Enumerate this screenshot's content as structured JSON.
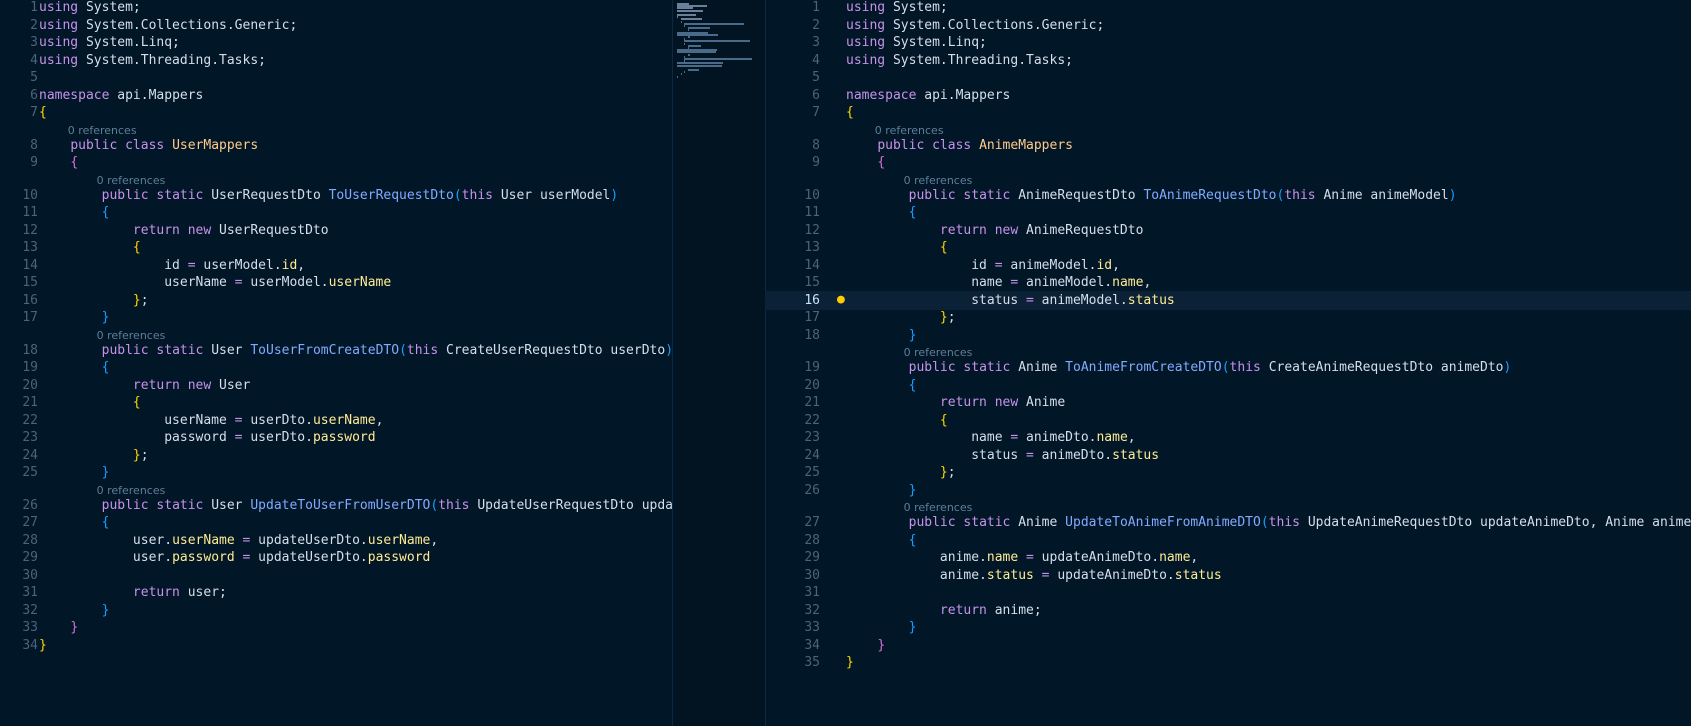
{
  "left": {
    "file_class": "UserMappers",
    "lines": [
      {
        "n": "1",
        "t": [
          [
            "kw",
            "using"
          ],
          [
            "ns",
            " System;"
          ]
        ]
      },
      {
        "n": "2",
        "t": [
          [
            "kw",
            "using"
          ],
          [
            "ns",
            " System.Collections.Generic;"
          ]
        ]
      },
      {
        "n": "3",
        "t": [
          [
            "kw",
            "using"
          ],
          [
            "ns",
            " System.Linq;"
          ]
        ]
      },
      {
        "n": "4",
        "t": [
          [
            "kw",
            "using"
          ],
          [
            "ns",
            " System.Threading.Tasks;"
          ]
        ]
      },
      {
        "n": "5",
        "t": []
      },
      {
        "n": "6",
        "t": [
          [
            "kw",
            "namespace"
          ],
          [
            "ns",
            " api.Mappers"
          ]
        ]
      },
      {
        "n": "7",
        "t": [
          [
            "brace-y",
            "{"
          ]
        ]
      },
      {
        "n": "8",
        "ref": "0 references",
        "t": [
          [
            "ns",
            "    "
          ],
          [
            "kw",
            "public class "
          ],
          [
            "cls",
            "UserMappers"
          ]
        ]
      },
      {
        "n": "9",
        "t": [
          [
            "ns",
            "    "
          ],
          [
            "brace-p",
            "{"
          ]
        ]
      },
      {
        "n": "10",
        "ref": "0 references",
        "t": [
          [
            "ns",
            "        "
          ],
          [
            "kw",
            "public static "
          ],
          [
            "ns",
            "UserRequestDto "
          ],
          [
            "fn",
            "ToUserRequestDto"
          ],
          [
            "brace-b",
            "("
          ],
          [
            "kw",
            "this "
          ],
          [
            "ns",
            "User userModel"
          ],
          [
            "brace-b",
            ")"
          ]
        ]
      },
      {
        "n": "11",
        "t": [
          [
            "ns",
            "        "
          ],
          [
            "brace-b",
            "{"
          ]
        ]
      },
      {
        "n": "12",
        "t": [
          [
            "ns",
            "            "
          ],
          [
            "kw",
            "return new "
          ],
          [
            "ns",
            "UserRequestDto"
          ]
        ]
      },
      {
        "n": "13",
        "t": [
          [
            "ns",
            "            "
          ],
          [
            "brace-y",
            "{"
          ]
        ]
      },
      {
        "n": "14",
        "t": [
          [
            "ns",
            "                id "
          ],
          [
            "op",
            "="
          ],
          [
            "ns",
            " userModel."
          ],
          [
            "prop",
            "id"
          ],
          [
            "ns",
            ","
          ]
        ]
      },
      {
        "n": "15",
        "t": [
          [
            "ns",
            "                userName "
          ],
          [
            "op",
            "="
          ],
          [
            "ns",
            " userModel."
          ],
          [
            "prop",
            "userName"
          ]
        ]
      },
      {
        "n": "16",
        "t": [
          [
            "ns",
            "            "
          ],
          [
            "brace-y",
            "}"
          ],
          [
            "ns",
            ";"
          ]
        ]
      },
      {
        "n": "17",
        "t": [
          [
            "ns",
            "        "
          ],
          [
            "brace-b",
            "}"
          ]
        ]
      },
      {
        "n": "18",
        "ref": "0 references",
        "t": [
          [
            "ns",
            "        "
          ],
          [
            "kw",
            "public static "
          ],
          [
            "ns",
            "User "
          ],
          [
            "fn",
            "ToUserFromCreateDTO"
          ],
          [
            "brace-b",
            "("
          ],
          [
            "kw",
            "this "
          ],
          [
            "ns",
            "CreateUserRequestDto userDto"
          ],
          [
            "brace-b",
            ")"
          ]
        ]
      },
      {
        "n": "19",
        "t": [
          [
            "ns",
            "        "
          ],
          [
            "brace-b",
            "{"
          ]
        ]
      },
      {
        "n": "20",
        "t": [
          [
            "ns",
            "            "
          ],
          [
            "kw",
            "return new "
          ],
          [
            "ns",
            "User"
          ]
        ]
      },
      {
        "n": "21",
        "t": [
          [
            "ns",
            "            "
          ],
          [
            "brace-y",
            "{"
          ]
        ]
      },
      {
        "n": "22",
        "t": [
          [
            "ns",
            "                userName "
          ],
          [
            "op",
            "="
          ],
          [
            "ns",
            " userDto."
          ],
          [
            "prop",
            "userName"
          ],
          [
            "ns",
            ","
          ]
        ]
      },
      {
        "n": "23",
        "t": [
          [
            "ns",
            "                password "
          ],
          [
            "op",
            "="
          ],
          [
            "ns",
            " userDto."
          ],
          [
            "prop",
            "password"
          ]
        ]
      },
      {
        "n": "24",
        "t": [
          [
            "ns",
            "            "
          ],
          [
            "brace-y",
            "}"
          ],
          [
            "ns",
            ";"
          ]
        ]
      },
      {
        "n": "25",
        "t": [
          [
            "ns",
            "        "
          ],
          [
            "brace-b",
            "}"
          ]
        ]
      },
      {
        "n": "26",
        "ref": "0 references",
        "t": [
          [
            "ns",
            "        "
          ],
          [
            "kw",
            "public static "
          ],
          [
            "ns",
            "User "
          ],
          [
            "fn",
            "UpdateToUserFromUserDTO"
          ],
          [
            "brace-b",
            "("
          ],
          [
            "kw",
            "this "
          ],
          [
            "ns",
            "UpdateUserRequestDto update"
          ]
        ]
      },
      {
        "n": "27",
        "t": [
          [
            "ns",
            "        "
          ],
          [
            "brace-b",
            "{"
          ]
        ]
      },
      {
        "n": "28",
        "t": [
          [
            "ns",
            "            user."
          ],
          [
            "prop",
            "userName"
          ],
          [
            "op",
            " ="
          ],
          [
            "ns",
            " updateUserDto."
          ],
          [
            "prop",
            "userName"
          ],
          [
            "ns",
            ","
          ]
        ]
      },
      {
        "n": "29",
        "t": [
          [
            "ns",
            "            user."
          ],
          [
            "prop",
            "password"
          ],
          [
            "op",
            " ="
          ],
          [
            "ns",
            " updateUserDto."
          ],
          [
            "prop",
            "password"
          ]
        ]
      },
      {
        "n": "30",
        "t": []
      },
      {
        "n": "31",
        "t": [
          [
            "ns",
            "            "
          ],
          [
            "kw",
            "return "
          ],
          [
            "ns",
            "user;"
          ]
        ]
      },
      {
        "n": "32",
        "t": [
          [
            "ns",
            "        "
          ],
          [
            "brace-b",
            "}"
          ]
        ]
      },
      {
        "n": "33",
        "t": [
          [
            "ns",
            "    "
          ],
          [
            "brace-p",
            "}"
          ]
        ]
      },
      {
        "n": "34",
        "t": [
          [
            "brace-y",
            "}"
          ]
        ]
      }
    ]
  },
  "right": {
    "file_class": "AnimeMappers",
    "active_line": "16",
    "lines": [
      {
        "n": "1",
        "t": [
          [
            "kw",
            "using"
          ],
          [
            "ns",
            " System;"
          ]
        ]
      },
      {
        "n": "2",
        "t": [
          [
            "kw",
            "using"
          ],
          [
            "ns",
            " System.Collections.Generic;"
          ]
        ]
      },
      {
        "n": "3",
        "t": [
          [
            "kw",
            "using"
          ],
          [
            "ns",
            " System.Linq;"
          ]
        ]
      },
      {
        "n": "4",
        "t": [
          [
            "kw",
            "using"
          ],
          [
            "ns",
            " System.Threading.Tasks;"
          ]
        ]
      },
      {
        "n": "5",
        "t": []
      },
      {
        "n": "6",
        "t": [
          [
            "kw",
            "namespace"
          ],
          [
            "ns",
            " api.Mappers"
          ]
        ]
      },
      {
        "n": "7",
        "t": [
          [
            "brace-y",
            "{"
          ]
        ]
      },
      {
        "n": "8",
        "ref": "0 references",
        "t": [
          [
            "ns",
            "    "
          ],
          [
            "kw",
            "public class "
          ],
          [
            "cls",
            "AnimeMappers"
          ]
        ]
      },
      {
        "n": "9",
        "t": [
          [
            "ns",
            "    "
          ],
          [
            "brace-p",
            "{"
          ]
        ]
      },
      {
        "n": "10",
        "ref": "0 references",
        "t": [
          [
            "ns",
            "        "
          ],
          [
            "kw",
            "public static "
          ],
          [
            "ns",
            "AnimeRequestDto "
          ],
          [
            "fn",
            "ToAnimeRequestDto"
          ],
          [
            "brace-b",
            "("
          ],
          [
            "kw",
            "this "
          ],
          [
            "ns",
            "Anime animeModel"
          ],
          [
            "brace-b",
            ")"
          ]
        ]
      },
      {
        "n": "11",
        "t": [
          [
            "ns",
            "        "
          ],
          [
            "brace-b",
            "{"
          ]
        ]
      },
      {
        "n": "12",
        "t": [
          [
            "ns",
            "            "
          ],
          [
            "kw",
            "return new "
          ],
          [
            "ns",
            "AnimeRequestDto"
          ]
        ]
      },
      {
        "n": "13",
        "t": [
          [
            "ns",
            "            "
          ],
          [
            "brace-y",
            "{"
          ]
        ]
      },
      {
        "n": "14",
        "t": [
          [
            "ns",
            "                id "
          ],
          [
            "op",
            "="
          ],
          [
            "ns",
            " animeModel."
          ],
          [
            "prop",
            "id"
          ],
          [
            "ns",
            ","
          ]
        ]
      },
      {
        "n": "15",
        "t": [
          [
            "ns",
            "                name "
          ],
          [
            "op",
            "="
          ],
          [
            "ns",
            " animeModel."
          ],
          [
            "prop",
            "name"
          ],
          [
            "ns",
            ","
          ]
        ]
      },
      {
        "n": "16",
        "t": [
          [
            "ns",
            "                status "
          ],
          [
            "op",
            "="
          ],
          [
            "ns",
            " animeModel."
          ],
          [
            "prop",
            "status"
          ]
        ]
      },
      {
        "n": "17",
        "t": [
          [
            "ns",
            "            "
          ],
          [
            "brace-y",
            "}"
          ],
          [
            "ns",
            ";"
          ]
        ]
      },
      {
        "n": "18",
        "t": [
          [
            "ns",
            "        "
          ],
          [
            "brace-b",
            "}"
          ]
        ]
      },
      {
        "n": "19",
        "ref": "0 references",
        "t": [
          [
            "ns",
            "        "
          ],
          [
            "kw",
            "public static "
          ],
          [
            "ns",
            "Anime "
          ],
          [
            "fn",
            "ToAnimeFromCreateDTO"
          ],
          [
            "brace-b",
            "("
          ],
          [
            "kw",
            "this "
          ],
          [
            "ns",
            "CreateAnimeRequestDto animeDto"
          ],
          [
            "brace-b",
            ")"
          ]
        ]
      },
      {
        "n": "20",
        "t": [
          [
            "ns",
            "        "
          ],
          [
            "brace-b",
            "{"
          ]
        ]
      },
      {
        "n": "21",
        "t": [
          [
            "ns",
            "            "
          ],
          [
            "kw",
            "return new "
          ],
          [
            "ns",
            "Anime"
          ]
        ]
      },
      {
        "n": "22",
        "t": [
          [
            "ns",
            "            "
          ],
          [
            "brace-y",
            "{"
          ]
        ]
      },
      {
        "n": "23",
        "t": [
          [
            "ns",
            "                name "
          ],
          [
            "op",
            "="
          ],
          [
            "ns",
            " animeDto."
          ],
          [
            "prop",
            "name"
          ],
          [
            "ns",
            ","
          ]
        ]
      },
      {
        "n": "24",
        "t": [
          [
            "ns",
            "                status "
          ],
          [
            "op",
            "="
          ],
          [
            "ns",
            " animeDto."
          ],
          [
            "prop",
            "status"
          ]
        ]
      },
      {
        "n": "25",
        "t": [
          [
            "ns",
            "            "
          ],
          [
            "brace-y",
            "}"
          ],
          [
            "ns",
            ";"
          ]
        ]
      },
      {
        "n": "26",
        "t": [
          [
            "ns",
            "        "
          ],
          [
            "brace-b",
            "}"
          ]
        ]
      },
      {
        "n": "27",
        "ref": "0 references",
        "t": [
          [
            "ns",
            "        "
          ],
          [
            "kw",
            "public static "
          ],
          [
            "ns",
            "Anime "
          ],
          [
            "fn",
            "UpdateToAnimeFromAnimeDTO"
          ],
          [
            "brace-b",
            "("
          ],
          [
            "kw",
            "this "
          ],
          [
            "ns",
            "UpdateAnimeRequestDto updateAnimeDto, Anime anime"
          ],
          [
            "brace-b",
            ")"
          ]
        ]
      },
      {
        "n": "28",
        "t": [
          [
            "ns",
            "        "
          ],
          [
            "brace-b",
            "{"
          ]
        ]
      },
      {
        "n": "29",
        "t": [
          [
            "ns",
            "            anime."
          ],
          [
            "prop",
            "name"
          ],
          [
            "op",
            " ="
          ],
          [
            "ns",
            " updateAnimeDto."
          ],
          [
            "prop",
            "name"
          ],
          [
            "ns",
            ","
          ]
        ]
      },
      {
        "n": "30",
        "t": [
          [
            "ns",
            "            anime."
          ],
          [
            "prop",
            "status"
          ],
          [
            "op",
            " ="
          ],
          [
            "ns",
            " updateAnimeDto."
          ],
          [
            "prop",
            "status"
          ]
        ]
      },
      {
        "n": "31",
        "t": []
      },
      {
        "n": "32",
        "t": [
          [
            "ns",
            "            "
          ],
          [
            "kw",
            "return "
          ],
          [
            "ns",
            "anime;"
          ]
        ]
      },
      {
        "n": "33",
        "t": [
          [
            "ns",
            "        "
          ],
          [
            "brace-b",
            "}"
          ]
        ]
      },
      {
        "n": "34",
        "t": [
          [
            "ns",
            "    "
          ],
          [
            "brace-p",
            "}"
          ]
        ]
      },
      {
        "n": "35",
        "t": [
          [
            "brace-y",
            "}"
          ]
        ]
      }
    ]
  },
  "icons": {
    "lightbulb": "lightbulb-icon"
  }
}
